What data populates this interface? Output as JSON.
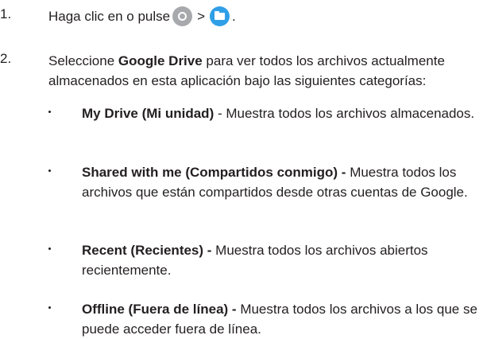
{
  "step1": {
    "number": "1.",
    "text_before": "Haga clic en o pulse",
    "separator": ">",
    "text_after": ".",
    "icons": [
      "launcher-icon",
      "files-app-icon"
    ],
    "colors": {
      "launcher": "#a7a9ac",
      "files": "#2f9fe7"
    }
  },
  "step2": {
    "number": "2.",
    "text_before": "Seleccione ",
    "bold": "Google Drive",
    "text_after": " para ver todos los archivos actualmente almacenados en esta aplicación bajo las siguientes categorías:"
  },
  "bullets": [
    {
      "bold": "My Drive (Mi unidad)",
      "text": " -  Muestra todos los archivos almacenados."
    },
    {
      "bold": "Shared with me (Compartidos conmigo) -",
      "text": " Muestra todos los archivos que están compartidos desde otras cuentas de Google."
    },
    {
      "bold": "Recent (Recientes) -",
      "text": " Muestra todos los archivos abiertos recientemente."
    },
    {
      "bold": "Offline (Fuera de línea) -",
      "text": " Muestra todos los archivos a los que se puede acceder fuera de línea."
    }
  ]
}
